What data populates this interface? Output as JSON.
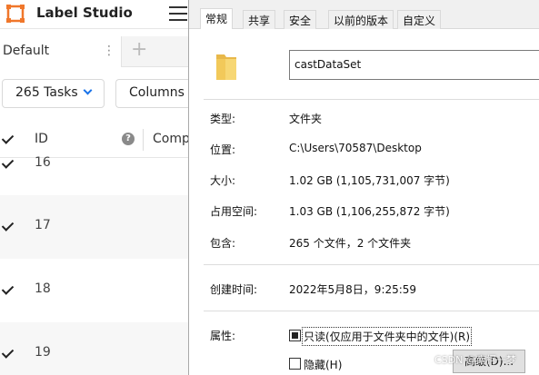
{
  "app": {
    "title": "Label Studio",
    "colors": {
      "logo": "#f0772b",
      "accent": "#1a73e8"
    }
  },
  "tabs": {
    "current": "Default",
    "add_symbol": "+"
  },
  "toolbar": {
    "tasks_label": "265 Tasks",
    "columns_label": "Columns"
  },
  "table": {
    "headers": {
      "id": "ID",
      "completed": "Compl"
    },
    "help_symbol": "?",
    "rows": [
      {
        "id": "16"
      },
      {
        "id": "17"
      },
      {
        "id": "18"
      },
      {
        "id": "19"
      }
    ]
  },
  "dialog": {
    "tabs": [
      "常规",
      "共享",
      "安全",
      "以前的版本",
      "自定义"
    ],
    "active_tab": "常规",
    "name_value": "castDataSet",
    "props": {
      "type": {
        "label": "类型:",
        "value": "文件夹"
      },
      "location": {
        "label": "位置:",
        "value": "C:\\Users\\70587\\Desktop"
      },
      "size": {
        "label": "大小:",
        "value": "1.02 GB (1,105,731,007 字节)"
      },
      "disk_size": {
        "label": "占用空间:",
        "value": "1.03 GB (1,106,255,872 字节)"
      },
      "contains": {
        "label": "包含:",
        "value": "265 个文件，2 个文件夹"
      },
      "created": {
        "label": "创建时间:",
        "value": "2022年5月8日，9:25:59"
      },
      "attributes": {
        "label": "属性:"
      }
    },
    "attributes": {
      "readonly_label": "只读(仅应用于文件夹中的文件)(R)",
      "hidden_label": "隐藏(H)"
    },
    "advanced_label": "高级(D)..."
  },
  "watermark": "CSDN @南柯一梦"
}
